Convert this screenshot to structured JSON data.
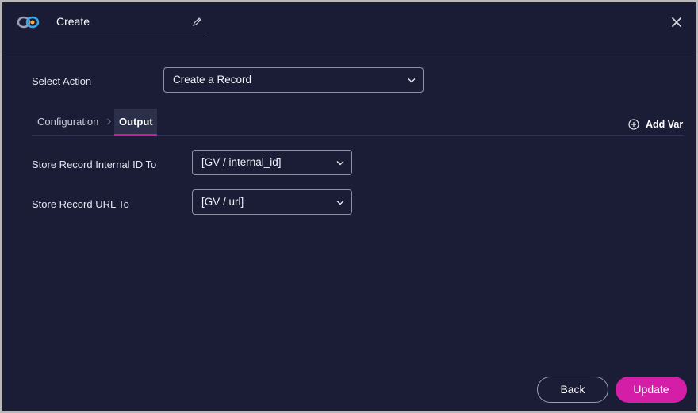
{
  "header": {
    "name": "Create",
    "logo_icon": "infinity-logo-icon",
    "edit_icon": "pencil-icon",
    "close_icon": "close-icon"
  },
  "action": {
    "label": "Select Action",
    "value": "Create a Record"
  },
  "tabs": [
    {
      "label": "Configuration",
      "active": false
    },
    {
      "label": "Output",
      "active": true
    }
  ],
  "add_var": {
    "label": "Add Var",
    "icon": "plus-circle-icon"
  },
  "outputs": [
    {
      "label": "Store Record Internal ID To",
      "value": "[GV / internal_id]"
    },
    {
      "label": "Store Record URL To",
      "value": "[GV / url]"
    }
  ],
  "footer": {
    "back_label": "Back",
    "update_label": "Update"
  },
  "colors": {
    "background": "#1b1d37",
    "accent": "#d41ea8"
  }
}
